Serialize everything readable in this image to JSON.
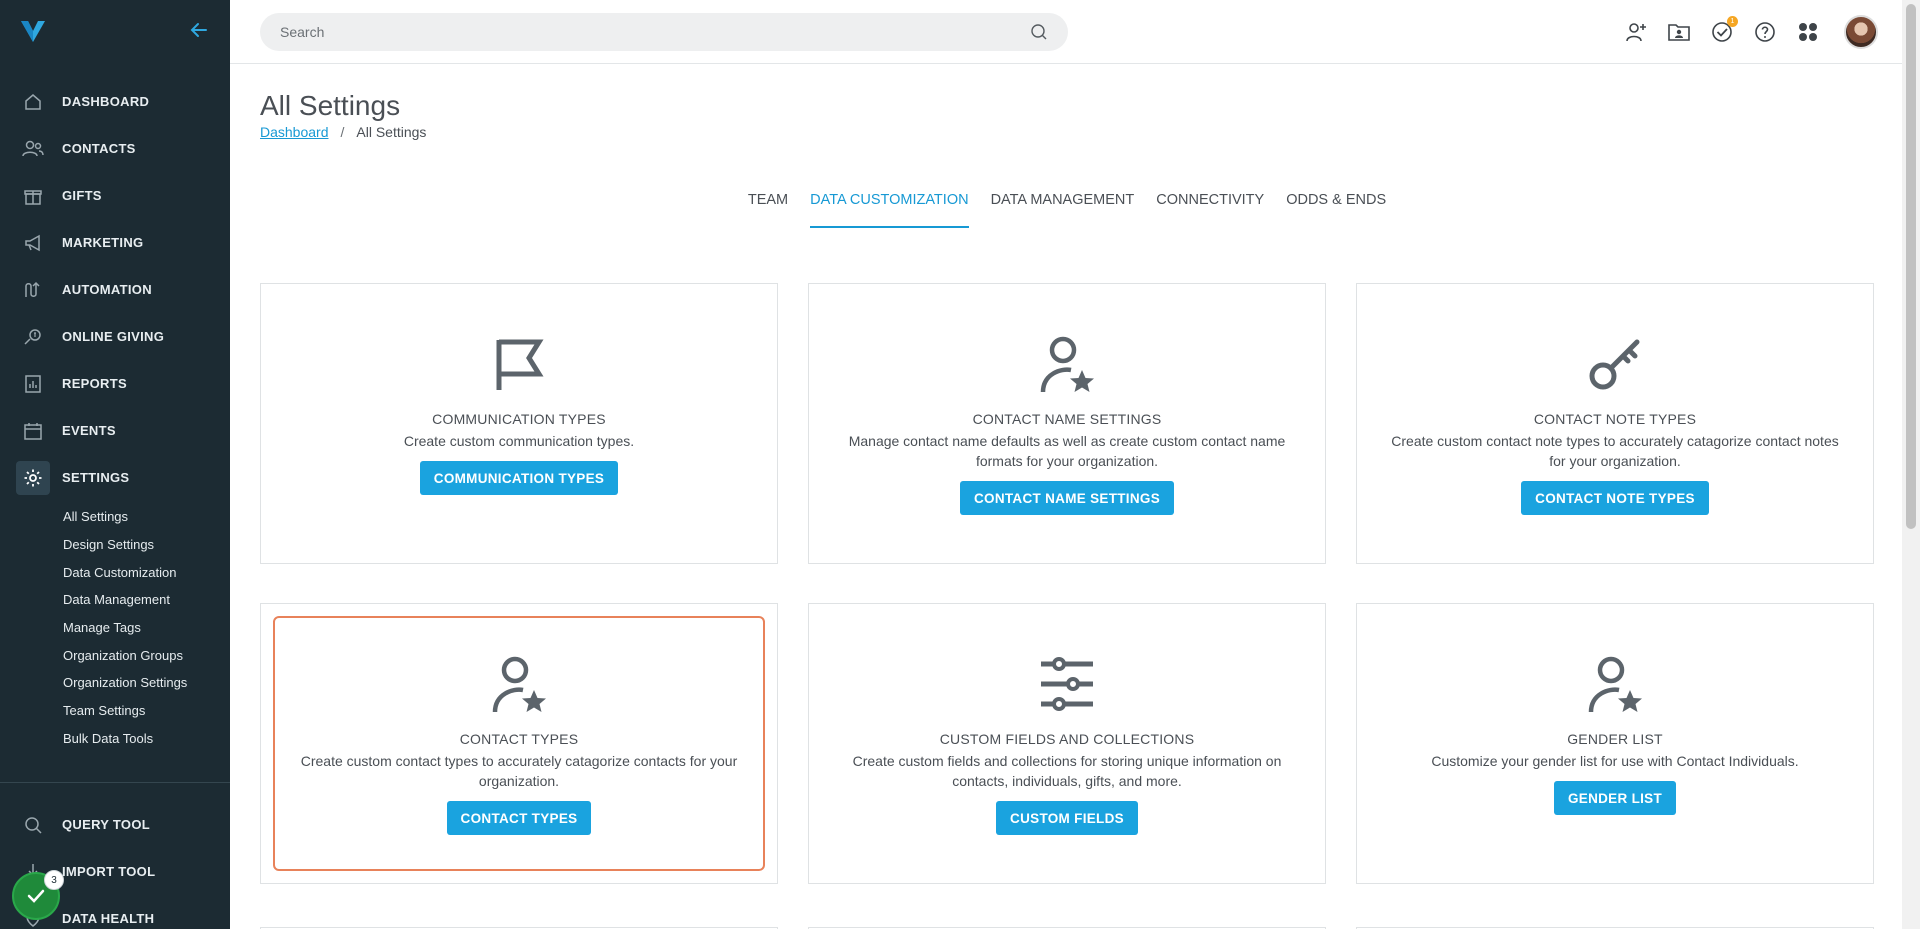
{
  "sidebar": {
    "nav": [
      {
        "label": "DASHBOARD",
        "icon": "home-icon"
      },
      {
        "label": "CONTACTS",
        "icon": "contacts-icon"
      },
      {
        "label": "GIFTS",
        "icon": "gift-icon"
      },
      {
        "label": "MARKETING",
        "icon": "megaphone-icon"
      },
      {
        "label": "AUTOMATION",
        "icon": "automation-icon"
      },
      {
        "label": "ONLINE GIVING",
        "icon": "online-giving-icon"
      },
      {
        "label": "REPORTS",
        "icon": "reports-icon"
      },
      {
        "label": "EVENTS",
        "icon": "calendar-icon"
      },
      {
        "label": "SETTINGS",
        "icon": "gear-icon"
      }
    ],
    "settings_sub": [
      "All Settings",
      "Design Settings",
      "Data Customization",
      "Data Management",
      "Manage Tags",
      "Organization Groups",
      "Organization Settings",
      "Team Settings",
      "Bulk Data Tools"
    ],
    "bottom": [
      {
        "label": "QUERY TOOL",
        "icon": "search-icon"
      },
      {
        "label": "IMPORT TOOL",
        "icon": "import-icon"
      },
      {
        "label": "DATA HEALTH",
        "icon": "data-health-icon"
      }
    ],
    "task_badge_count": "3"
  },
  "topbar": {
    "search_placeholder": "Search",
    "notification_count": "1"
  },
  "page": {
    "title": "All Settings",
    "breadcrumb": {
      "link": "Dashboard",
      "current": "All Settings"
    }
  },
  "tabs": [
    "TEAM",
    "DATA CUSTOMIZATION",
    "DATA MANAGEMENT",
    "CONNECTIVITY",
    "ODDS & ENDS"
  ],
  "cards": [
    {
      "icon": "flag-icon",
      "title": "COMMUNICATION TYPES",
      "desc": "Create custom communication types.",
      "button": "COMMUNICATION TYPES"
    },
    {
      "icon": "user-star-icon",
      "title": "CONTACT NAME SETTINGS",
      "desc": "Manage contact name defaults as well as create custom contact name formats for your organization.",
      "button": "CONTACT NAME SETTINGS"
    },
    {
      "icon": "key-icon",
      "title": "CONTACT NOTE TYPES",
      "desc": "Create custom contact note types to accurately catagorize contact notes for your organization.",
      "button": "CONTACT NOTE TYPES"
    },
    {
      "icon": "user-star-icon",
      "title": "CONTACT TYPES",
      "desc": "Create custom contact types to accurately catagorize contacts for your organization.",
      "button": "CONTACT TYPES"
    },
    {
      "icon": "sliders-icon",
      "title": "CUSTOM FIELDS AND COLLECTIONS",
      "desc": "Create custom fields and collections for storing unique information on contacts, individuals, gifts, and more.",
      "button": "CUSTOM FIELDS"
    },
    {
      "icon": "user-star-icon",
      "title": "GENDER LIST",
      "desc": "Customize your gender list for use with Contact Individuals.",
      "button": "GENDER LIST"
    }
  ],
  "colors": {
    "accent": "#1aa3df",
    "sidebar_bg": "#1c2b33",
    "highlight": "#e8825a"
  }
}
